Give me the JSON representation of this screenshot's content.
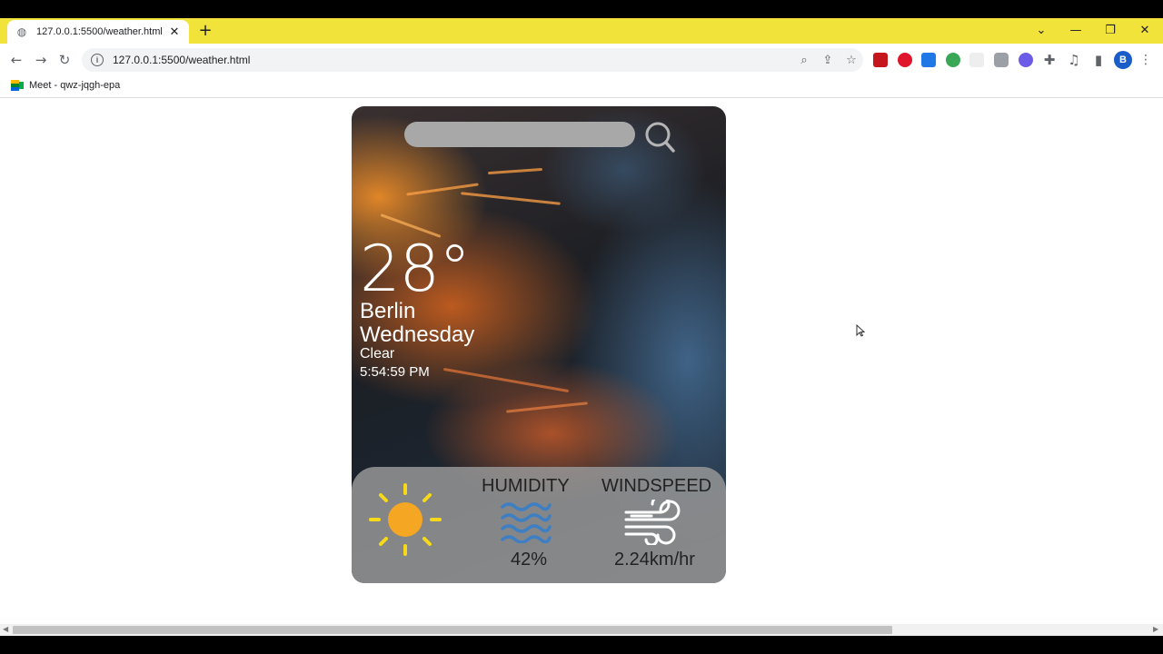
{
  "browser": {
    "tab_title": "127.0.0.1:5500/weather.html",
    "url": "127.0.0.1:5500/weather.html",
    "bookmark_label": "Meet - qwz-jqgh-epa",
    "profile_initial": "B",
    "tabstrip_color": "#f2e33a"
  },
  "weather": {
    "search_value": "",
    "temperature": "28°",
    "city": "Berlin",
    "day": "Wednesday",
    "condition": "Clear",
    "time": "5:54:59 PM",
    "condition_icon": "sun-icon",
    "humidity_label": "HUMIDITY",
    "humidity_value": "42%",
    "humidity_icon": "waves-icon",
    "windspeed_label": "WINDSPEED",
    "windspeed_value": "2.24km/hr",
    "windspeed_icon": "wind-icon"
  }
}
